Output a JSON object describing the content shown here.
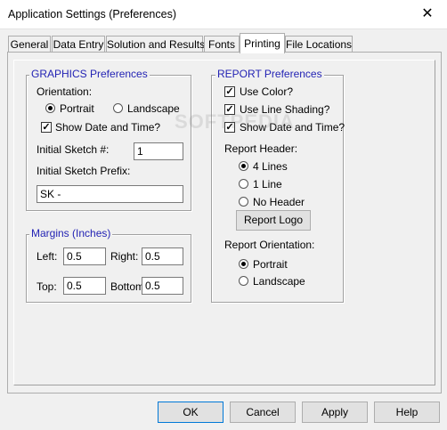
{
  "window": {
    "title": "Application Settings (Preferences)",
    "close_glyph": "✕"
  },
  "tabs": [
    "General",
    "Data Entry",
    "Solution and Results",
    "Fonts",
    "Printing",
    "File Locations"
  ],
  "active_tab": "Printing",
  "graphics": {
    "legend": "GRAPHICS Preferences",
    "orientation_label": "Orientation:",
    "portrait": "Portrait",
    "landscape": "Landscape",
    "orientation_selected": "Portrait",
    "show_date_time": "Show Date and Time?",
    "show_date_time_checked": true,
    "initial_sketch_label": "Initial Sketch #:",
    "initial_sketch_value": "1",
    "prefix_label": "Initial Sketch Prefix:",
    "prefix_value": "SK -"
  },
  "margins": {
    "legend": "Margins (Inches)",
    "left_label": "Left:",
    "left_value": "0.5",
    "right_label": "Right:",
    "right_value": "0.5",
    "top_label": "Top:",
    "top_value": "0.5",
    "bottom_label": "Bottom:",
    "bottom_value": "0.5"
  },
  "report": {
    "legend": "REPORT Preferences",
    "use_color": "Use Color?",
    "use_color_checked": true,
    "use_line_shading": "Use Line Shading?",
    "use_line_shading_checked": true,
    "show_date_time": "Show Date and Time?",
    "show_date_time_checked": true,
    "header_label": "Report Header:",
    "header_4": "4 Lines",
    "header_1": "1 Line",
    "header_none": "No Header",
    "header_selected": "4 Lines",
    "logo_button": "Report Logo",
    "orientation_label": "Report Orientation:",
    "portrait": "Portrait",
    "landscape": "Landscape",
    "orientation_selected": "Portrait"
  },
  "buttons": {
    "ok": "OK",
    "cancel": "Cancel",
    "apply": "Apply",
    "help": "Help"
  },
  "watermark": "SOFTPEDIA"
}
